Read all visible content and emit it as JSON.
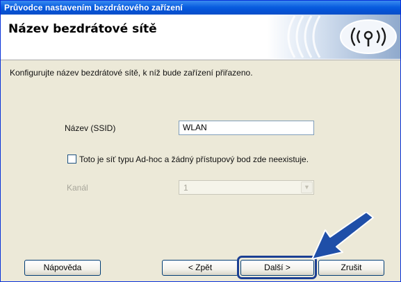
{
  "window": {
    "title": "Průvodce nastavením bezdrátového zařízení"
  },
  "header": {
    "title": "Název bezdrátové sítě",
    "logo_icon": "wireless-signal-logo"
  },
  "instruction": "Konfigurujte název bezdrátové sítě, k níž bude zařízení přiřazeno.",
  "form": {
    "ssid_label": "Název (SSID)",
    "ssid_value": "WLAN",
    "adhoc_checkbox_label": "Toto je síť typu Ad-hoc a žádný přístupový bod zde neexistuje.",
    "adhoc_checked": false,
    "channel_label": "Kanál",
    "channel_value": "1"
  },
  "buttons": {
    "help": "Nápověda",
    "back": "< Zpět",
    "next": "Další >",
    "cancel": "Zrušit"
  },
  "colors": {
    "titlebar": "#0553d6",
    "highlight": "#1b3f93",
    "arrow": "#1f4fa8"
  }
}
